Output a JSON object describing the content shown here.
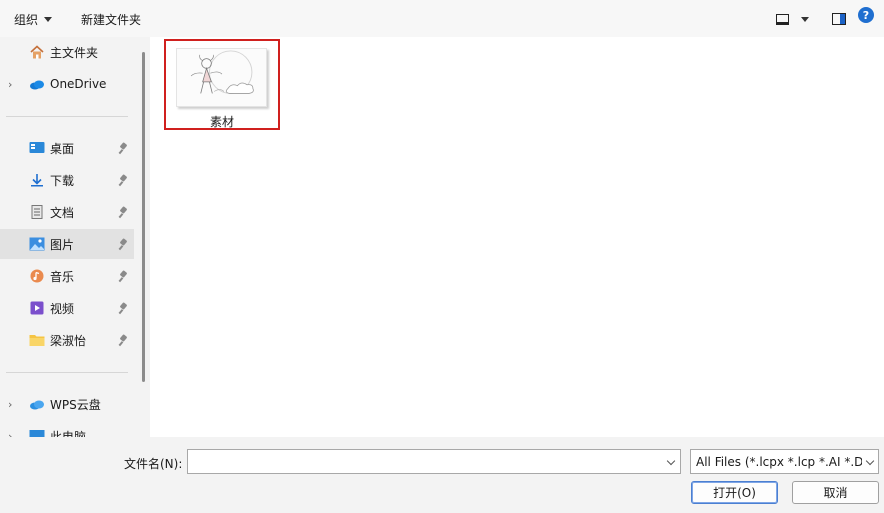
{
  "toolbar": {
    "organize_label": "组织",
    "new_folder_label": "新建文件夹",
    "help_glyph": "?"
  },
  "sidebar": {
    "items": [
      {
        "label": "主文件夹",
        "icon": "home-icon"
      },
      {
        "label": "OneDrive",
        "icon": "cloud-icon"
      },
      {
        "label": "桌面",
        "icon": "desktop-icon",
        "pinned": true
      },
      {
        "label": "下载",
        "icon": "download-icon",
        "pinned": true
      },
      {
        "label": "文档",
        "icon": "document-icon",
        "pinned": true
      },
      {
        "label": "图片",
        "icon": "pictures-icon",
        "pinned": true,
        "selected": true
      },
      {
        "label": "音乐",
        "icon": "music-icon",
        "pinned": true
      },
      {
        "label": "视频",
        "icon": "video-icon",
        "pinned": true
      },
      {
        "label": "梁淑怡",
        "icon": "folder-icon",
        "pinned": true
      },
      {
        "label": "WPS云盘",
        "icon": "cloud-icon"
      },
      {
        "label": "此电脑",
        "icon": "computer-icon"
      }
    ]
  },
  "content": {
    "files": [
      {
        "name": "素材",
        "type": "image",
        "selected": true
      }
    ]
  },
  "footer": {
    "filename_label": "文件名(N):",
    "filename_value": "",
    "filter_value": "All Files (*.lcpx *.lcp *.AI *.DXF",
    "open_label": "打开(O)",
    "cancel_label": "取消"
  },
  "colors": {
    "accent": "#1f6fd0",
    "selection_border": "#d0201e",
    "sidebar_bg": "#f3f3f3",
    "content_bg": "#ffffff"
  }
}
